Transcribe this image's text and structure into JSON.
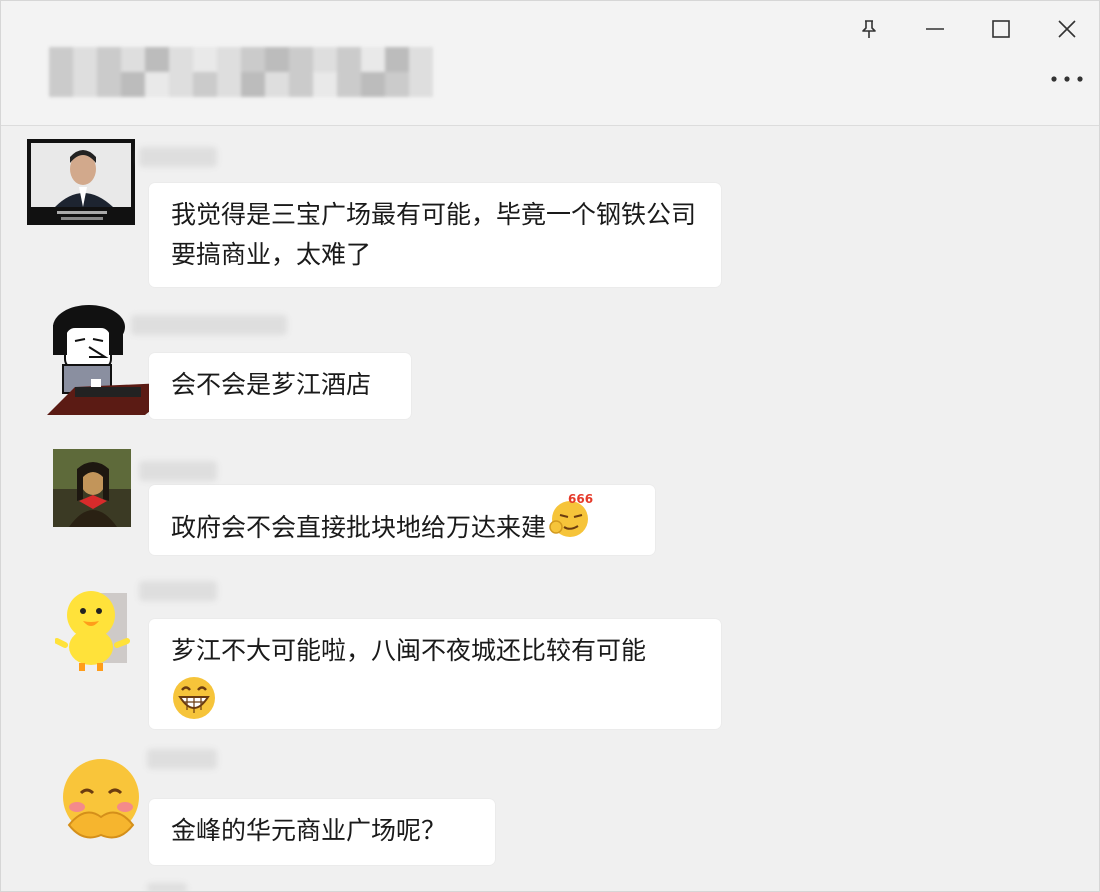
{
  "window": {
    "controls": {
      "pin_icon": "pin-icon",
      "minimize_icon": "minimize-icon",
      "maximize_icon": "maximize-icon",
      "close_icon": "close-icon",
      "more_icon": "more-icon"
    }
  },
  "messages": [
    {
      "text": "我觉得是三宝广场最有可能，毕竟一个钢铁公司要搞商业，太难了"
    },
    {
      "text": "会不会是芗江酒店"
    },
    {
      "text": "政府会不会直接批块地给万达来建",
      "emoji": "666-emoji",
      "emoji_text": "666"
    },
    {
      "text": "芗江不大可能啦，八闽不夜城还比较有可能",
      "emoji": "grin-emoji"
    },
    {
      "text": "金峰的华元商业广场呢？"
    }
  ],
  "colors": {
    "bubble": "#ffffff",
    "background": "#f0f0f0"
  }
}
